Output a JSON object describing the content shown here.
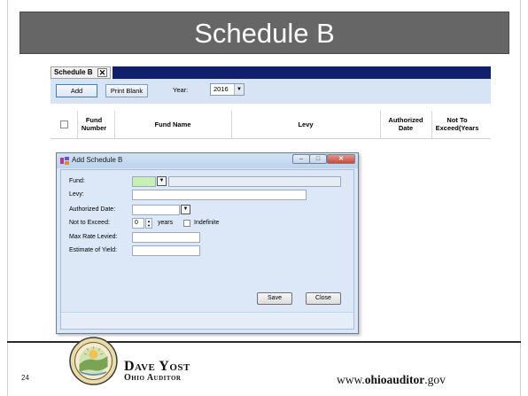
{
  "slide": {
    "title": "Schedule B",
    "page_number": "24",
    "footer": {
      "name": "Dave Yost",
      "title": "Ohio Auditor",
      "website": "www.ohioauditor.gov"
    }
  },
  "app": {
    "tab_label": "Schedule B",
    "tab_close": "✕",
    "toolbar": {
      "add_label": "Add",
      "print_label": "Print Blank",
      "year_label": "Year:",
      "year_value": "2016"
    },
    "columns": [
      "Fund Number",
      "Fund Name",
      "Levy",
      "Authorized Date",
      "Not To Exceed(Years"
    ]
  },
  "dialog": {
    "title": "Add Schedule B",
    "fields": {
      "fund_label": "Fund:",
      "levy_label": "Levy:",
      "authorized_date_label": "Authorized Date:",
      "not_to_exceed_label": "Not to Exceed:",
      "not_to_exceed_value": "0",
      "years_label": "years",
      "indefinite_label": "Indefinite",
      "max_rate_label": "Max Rate Levied:",
      "estimate_label": "Estimate of Yield:"
    },
    "save_label": "Save",
    "close_label": "Close"
  },
  "colors": {
    "title_bar": "#666666",
    "tab_strip": "#10206e",
    "toolbar": "#d6e4f5",
    "dialog_body": "#dce8f8",
    "fund_field": "#c8f0b4"
  }
}
